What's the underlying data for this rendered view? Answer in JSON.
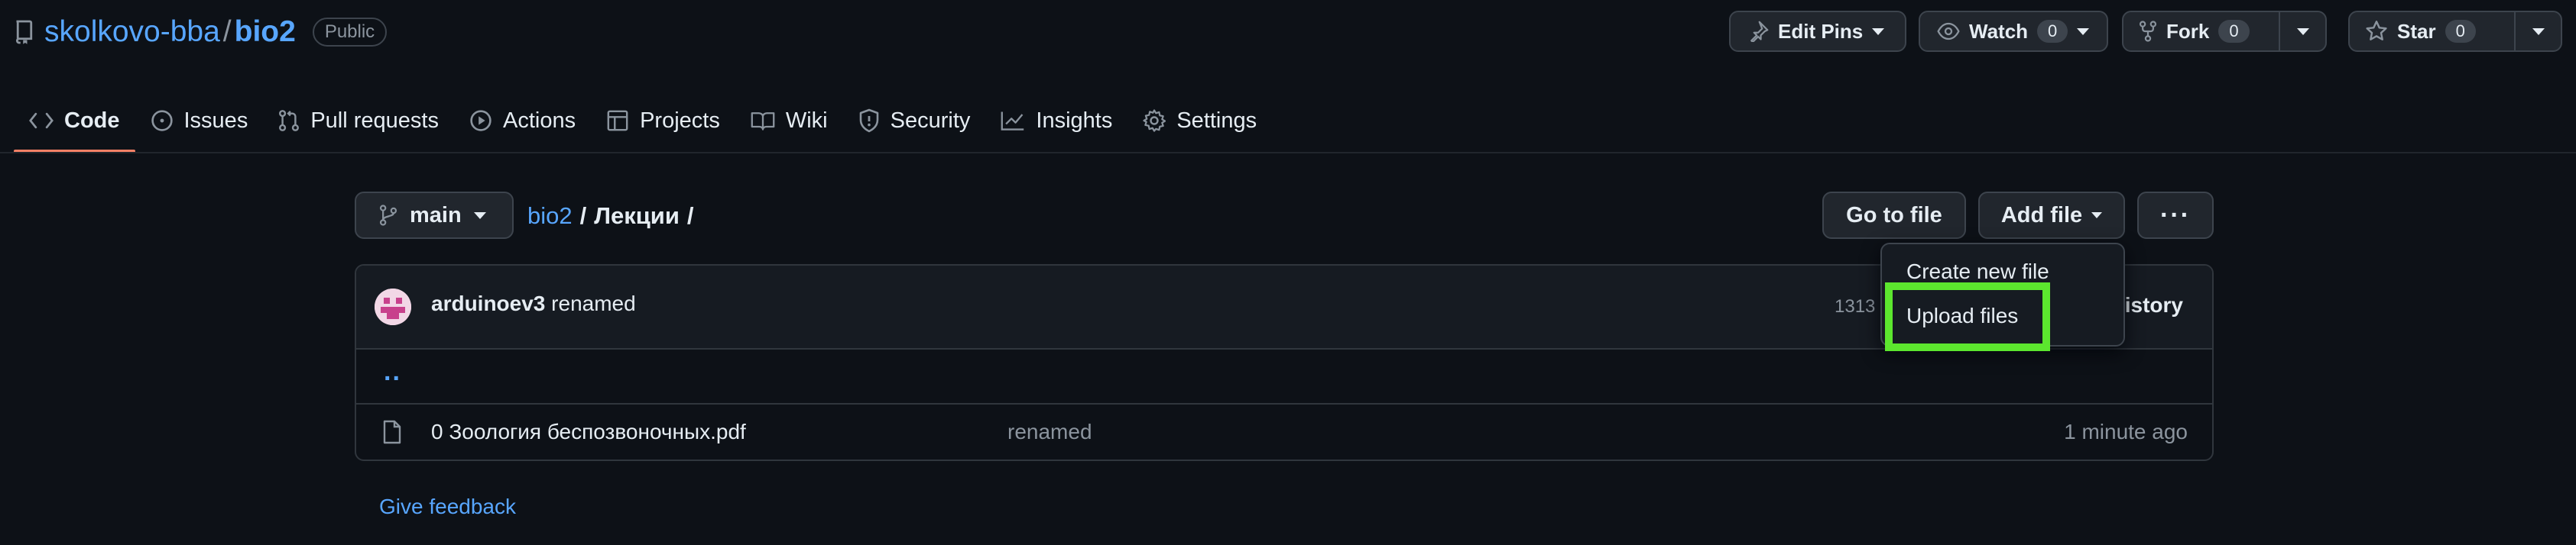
{
  "repo": {
    "owner": "skolkovo-bba",
    "separator": "/",
    "name": "bio2",
    "visibility": "Public"
  },
  "header_actions": {
    "edit_pins": "Edit Pins",
    "watch": {
      "label": "Watch",
      "count": "0"
    },
    "fork": {
      "label": "Fork",
      "count": "0"
    },
    "star": {
      "label": "Star",
      "count": "0"
    }
  },
  "tabs": [
    {
      "label": "Code",
      "icon": "code-icon",
      "active": true
    },
    {
      "label": "Issues",
      "icon": "issue-icon"
    },
    {
      "label": "Pull requests",
      "icon": "pull-request-icon"
    },
    {
      "label": "Actions",
      "icon": "play-icon"
    },
    {
      "label": "Projects",
      "icon": "table-icon"
    },
    {
      "label": "Wiki",
      "icon": "book-icon"
    },
    {
      "label": "Security",
      "icon": "shield-icon"
    },
    {
      "label": "Insights",
      "icon": "graph-icon"
    },
    {
      "label": "Settings",
      "icon": "gear-icon"
    }
  ],
  "file_nav": {
    "branch": "main",
    "breadcrumb_repo": "bio2",
    "breadcrumb_sep": "/",
    "breadcrumb_dir": "Лекции",
    "breadcrumb_trailing": "/",
    "go_to_file": "Go to file",
    "add_file": "Add file",
    "more": "···"
  },
  "commit": {
    "author": "arduinoev3",
    "message": "renamed",
    "hash_partial": "1313",
    "history_label": "istory"
  },
  "parent_dir": "..",
  "files": [
    {
      "name": "0 Зоология беспозвоночных.pdf",
      "message": "renamed",
      "age": "1 minute ago"
    }
  ],
  "feedback": "Give feedback",
  "add_file_menu": {
    "items": [
      "Create new file",
      "Upload files"
    ]
  },
  "colors": {
    "background": "#0d1117",
    "link": "#58a6ff",
    "active_tab_underline": "#f78166",
    "highlight": "#5ce62e"
  }
}
